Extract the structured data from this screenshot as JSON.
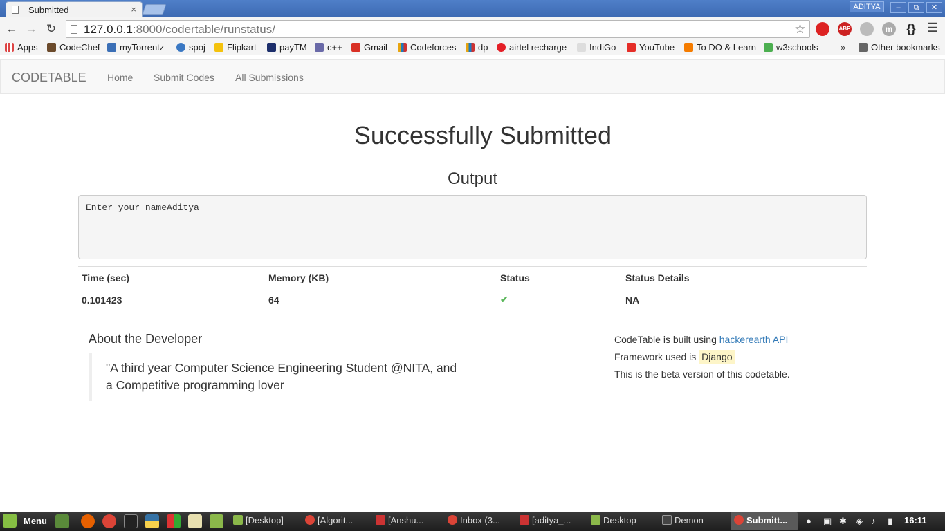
{
  "browser": {
    "tab_title": "Submitted",
    "tab_close": "×",
    "user_badge": "ADITYA",
    "window_buttons": [
      "–",
      "⧉",
      "✕"
    ],
    "url_host": "127.0.0.1",
    "url_path": ":8000/codertable/runstatus/",
    "extensions": [
      "ABP",
      "m"
    ],
    "bookmarks": [
      {
        "label": "Apps",
        "color": "#d44"
      },
      {
        "label": "CodeChef",
        "color": "#6b4a2b"
      },
      {
        "label": "myTorrentz",
        "color": "#3b6fb6"
      },
      {
        "label": "spoj",
        "color": "#3a78c3"
      },
      {
        "label": "Flipkart",
        "color": "#f4c20d"
      },
      {
        "label": "payTM",
        "color": "#1c2e6b"
      },
      {
        "label": "c++",
        "color": "#6a6aa8"
      },
      {
        "label": "Gmail",
        "color": "#d93025"
      },
      {
        "label": "Codeforces",
        "color": "#e8a40e"
      },
      {
        "label": "dp",
        "color": "#3a78c3"
      },
      {
        "label": "airtel recharge",
        "color": "#e41e26"
      },
      {
        "label": "IndiGo",
        "color": "#555"
      },
      {
        "label": "YouTube",
        "color": "#e52d27"
      },
      {
        "label": "To DO & Learn",
        "color": "#f57c00"
      },
      {
        "label": "w3schools",
        "color": "#4caf50"
      }
    ],
    "bookmarks_more": "»",
    "other_bookmarks": "Other bookmarks"
  },
  "navbar": {
    "brand": "CODETABLE",
    "links": [
      "Home",
      "Submit Codes",
      "All Submissions"
    ]
  },
  "main": {
    "heading": "Successfully Submitted",
    "output_heading": "Output",
    "output_text": "Enter your nameAditya",
    "table": {
      "headers": [
        "Time (sec)",
        "Memory (KB)",
        "Status",
        "Status Details"
      ],
      "row": {
        "time": "0.101423",
        "memory": "64",
        "status_icon": "✔",
        "details": "NA"
      }
    },
    "about": {
      "heading": "About the Developer",
      "quote": "\"A third year Computer Science Engineering Student @NITA, and a Competitive programming lover"
    },
    "side": {
      "line1_prefix": "CodeTable is built using",
      "line1_link": "hackerearth API",
      "line2_prefix": "Framework used is",
      "line2_code": "Django",
      "line3": "This is the beta version of this codetable."
    }
  },
  "taskbar": {
    "menu_label": "Menu",
    "items": [
      {
        "label": "[Desktop]",
        "icon_color": "#8bb84a"
      },
      {
        "label": "[Algorit...",
        "icon_color": "#db4437"
      },
      {
        "label": "[Anshu...",
        "icon_color": "#c33"
      },
      {
        "label": "Inbox (3...",
        "icon_color": "#db4437"
      },
      {
        "label": "[aditya_...",
        "icon_color": "#c33"
      },
      {
        "label": "Desktop",
        "icon_color": "#8bb84a"
      },
      {
        "label": "Demon",
        "icon_color": "#444"
      },
      {
        "label": "Submitt...",
        "icon_color": "#db4437"
      }
    ],
    "clock": "16:11"
  },
  "colors": {
    "accent_link": "#337ab7",
    "success": "#5cb85c",
    "code_bg": "#fdf5c8"
  }
}
